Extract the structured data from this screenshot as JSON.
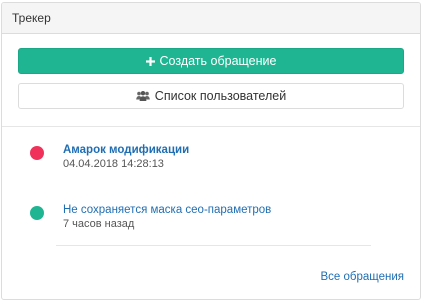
{
  "panel": {
    "title": "Трекер"
  },
  "actions": {
    "create_label": "Создать обращение",
    "users_label": "Список пользователей"
  },
  "tickets": [
    {
      "title": "Амарок модификации",
      "meta": "04.04.2018 14:28:13",
      "status_color": "#f0325a"
    },
    {
      "title": "Не сохраняется маска сео-параметров",
      "meta": "7 часов назад",
      "status_color": "#1fb592"
    }
  ],
  "footer": {
    "all_link": "Все обращения"
  },
  "colors": {
    "accent": "#1fb592",
    "link": "#1f6eb3",
    "unread": "#f0325a"
  },
  "icons": {
    "create": "plus-icon",
    "users": "users-icon"
  }
}
